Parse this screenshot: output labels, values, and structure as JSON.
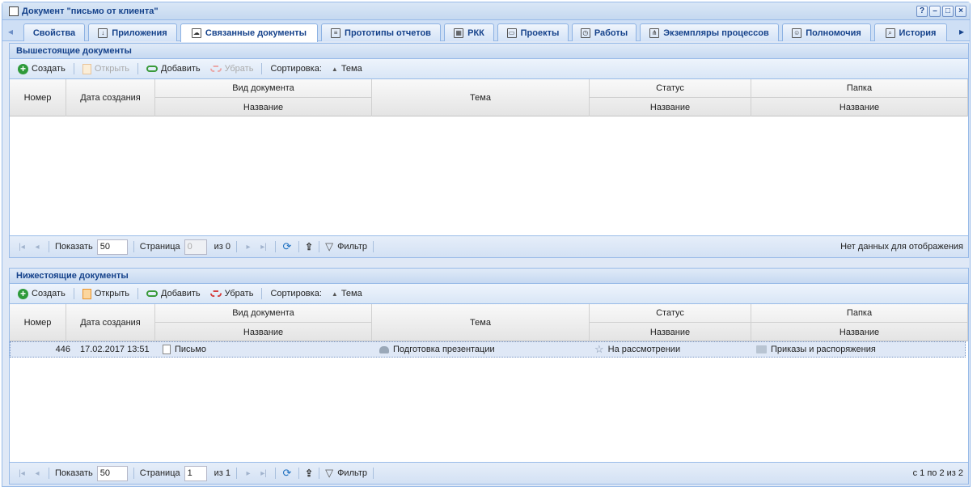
{
  "window": {
    "title": "Документ \"письмо от клиента\"",
    "tools": [
      "?",
      "–",
      "□",
      "×"
    ]
  },
  "tabs": [
    {
      "label": "Свойства",
      "icon": "properties-icon"
    },
    {
      "label": "Приложения",
      "icon": "attachment-icon"
    },
    {
      "label": "Связанные документы",
      "icon": "related-docs-icon",
      "active": true
    },
    {
      "label": "Прототипы отчетов",
      "icon": "report-icon"
    },
    {
      "label": "РКК",
      "icon": "rkk-icon"
    },
    {
      "label": "Проекты",
      "icon": "projects-icon"
    },
    {
      "label": "Работы",
      "icon": "works-icon"
    },
    {
      "label": "Экземпляры процессов",
      "icon": "process-icon"
    },
    {
      "label": "Полномочия",
      "icon": "permissions-icon"
    },
    {
      "label": "История",
      "icon": "history-icon"
    }
  ],
  "toolbar": {
    "create": "Создать",
    "open": "Открыть",
    "add": "Добавить",
    "remove": "Убрать",
    "sort_label": "Сортировка:",
    "sort_field": "Тема"
  },
  "columns": {
    "number": "Номер",
    "created": "Дата создания",
    "doc_type": "Вид документа",
    "doc_type_name": "Название",
    "subject": "Тема",
    "status": "Статус",
    "status_name": "Название",
    "folder": "Папка",
    "folder_name": "Название"
  },
  "pager": {
    "show": "Показать",
    "page_size": "50",
    "page": "Страница",
    "filter": "Фильтр"
  },
  "upper": {
    "title": "Вышестоящие документы",
    "page_value": "0",
    "of": "из 0",
    "info": "Нет данных для отображения",
    "rows": []
  },
  "lower": {
    "title": "Нижестоящие документы",
    "page_value": "1",
    "of": "из 1",
    "info": "с 1 по 2 из 2",
    "rows": [
      {
        "number": "446",
        "created": "17.02.2017 13:51",
        "doc_type": "Письмо",
        "subject": "Подготовка презентации",
        "status": "На рассмотрении",
        "folder": "Приказы и распоряжения"
      }
    ]
  }
}
